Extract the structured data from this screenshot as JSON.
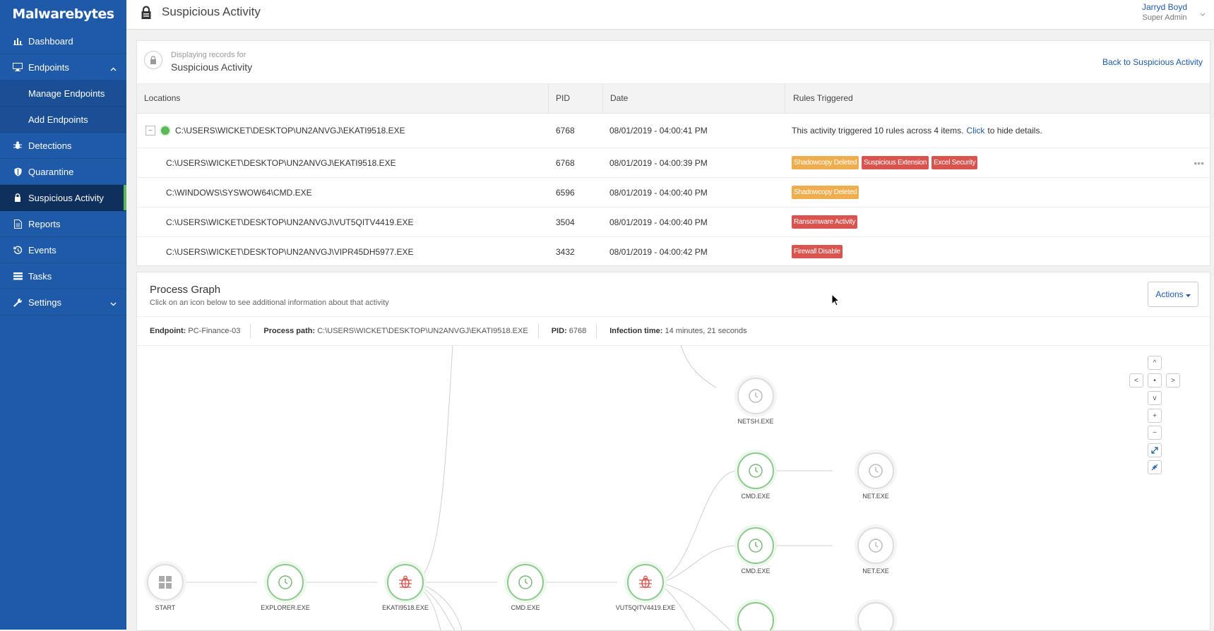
{
  "brand": {
    "name": "Malwarebytes"
  },
  "sidebar": {
    "items": [
      {
        "label": "Dashboard",
        "icon": "bar-chart-icon"
      },
      {
        "label": "Endpoints",
        "icon": "monitor-icon"
      },
      {
        "label": "Manage Endpoints"
      },
      {
        "label": "Add Endpoints"
      },
      {
        "label": "Detections",
        "icon": "bug-icon"
      },
      {
        "label": "Quarantine",
        "icon": "shield-icon"
      },
      {
        "label": "Suspicious Activity",
        "icon": "lock-icon"
      },
      {
        "label": "Reports",
        "icon": "document-icon"
      },
      {
        "label": "Events",
        "icon": "history-icon"
      },
      {
        "label": "Tasks",
        "icon": "list-icon"
      },
      {
        "label": "Settings",
        "icon": "wrench-icon"
      }
    ]
  },
  "header": {
    "title": "Suspicious Activity",
    "user_name": "Jarryd Boyd",
    "user_role": "Super Admin"
  },
  "records": {
    "displaying_label": "Displaying records for",
    "title": "Suspicious Activity",
    "back_link": "Back to Suspicious Activity",
    "columns": [
      "Locations",
      "PID",
      "Date",
      "Rules Triggered"
    ],
    "parent": {
      "location": "C:\\USERS\\WICKET\\DESKTOP\\UN2ANVGJ\\EKATI9518.EXE",
      "pid": "6768",
      "date": "08/01/2019 - 04:00:41 PM",
      "summary_prefix": "This activity triggered 10 rules across 4 items.",
      "summary_link": "Click",
      "summary_suffix": "to hide details."
    },
    "rows": [
      {
        "location": "C:\\USERS\\WICKET\\DESKTOP\\UN2ANVGJ\\EKATI9518.EXE",
        "pid": "6768",
        "date": "08/01/2019 - 04:00:39 PM",
        "rules": [
          {
            "label": "Shadowcopy Deleted",
            "color": "#f0ad4e"
          },
          {
            "label": "Suspicious Extension",
            "color": "#d9534f"
          },
          {
            "label": "Excel Security",
            "color": "#d9534f"
          }
        ]
      },
      {
        "location": "C:\\WINDOWS\\SYSWOW64\\CMD.EXE",
        "pid": "6596",
        "date": "08/01/2019 - 04:00:40 PM",
        "rules": [
          {
            "label": "Shadowcopy Deleted",
            "color": "#f0ad4e"
          }
        ]
      },
      {
        "location": "C:\\USERS\\WICKET\\DESKTOP\\UN2ANVGJ\\VUT5QITV4419.EXE",
        "pid": "3504",
        "date": "08/01/2019 - 04:00:40 PM",
        "rules": [
          {
            "label": "Ransomware Activity",
            "color": "#d9534f"
          }
        ]
      },
      {
        "location": "C:\\USERS\\WICKET\\DESKTOP\\UN2ANVGJ\\VIPR45DH5977.EXE",
        "pid": "3432",
        "date": "08/01/2019 - 04:00:42 PM",
        "rules": [
          {
            "label": "Firewall Disable",
            "color": "#d9534f"
          }
        ]
      }
    ]
  },
  "graph": {
    "title": "Process Graph",
    "subtitle": "Click on an icon below to see additional information about that activity",
    "actions_label": "Actions",
    "info": {
      "endpoint_label": "Endpoint:",
      "endpoint": "PC-Finance-03",
      "path_label": "Process path:",
      "path": "C:\\USERS\\WICKET\\DESKTOP\\UN2ANVGJ\\EKATI9518.EXE",
      "pid_label": "PID:",
      "pid": "6768",
      "infection_label": "Infection time:",
      "infection": "14 minutes, 21 seconds"
    },
    "nodes": {
      "start": "START",
      "explorer": "EXPLORER.EXE",
      "ekati": "EKATI9518.EXE",
      "cmd_main": "CMD.EXE",
      "vut": "VUT5QITV4419.EXE",
      "netsh": "NETSH.EXE",
      "cmd1": "CMD.EXE",
      "net1": "NET.EXE",
      "cmd2": "CMD.EXE",
      "net2": "NET.EXE"
    },
    "controls": {
      "up": "^",
      "left": "<",
      "center": "•",
      "right": ">",
      "down": "v",
      "zoom_in": "+",
      "zoom_out": "−"
    }
  },
  "colors": {
    "sidebar": "#1e5aa8",
    "active": "#0f2f5c",
    "accent_green": "#5cb85c",
    "tag_yellow": "#f0ad4e",
    "tag_red": "#d9534f"
  }
}
